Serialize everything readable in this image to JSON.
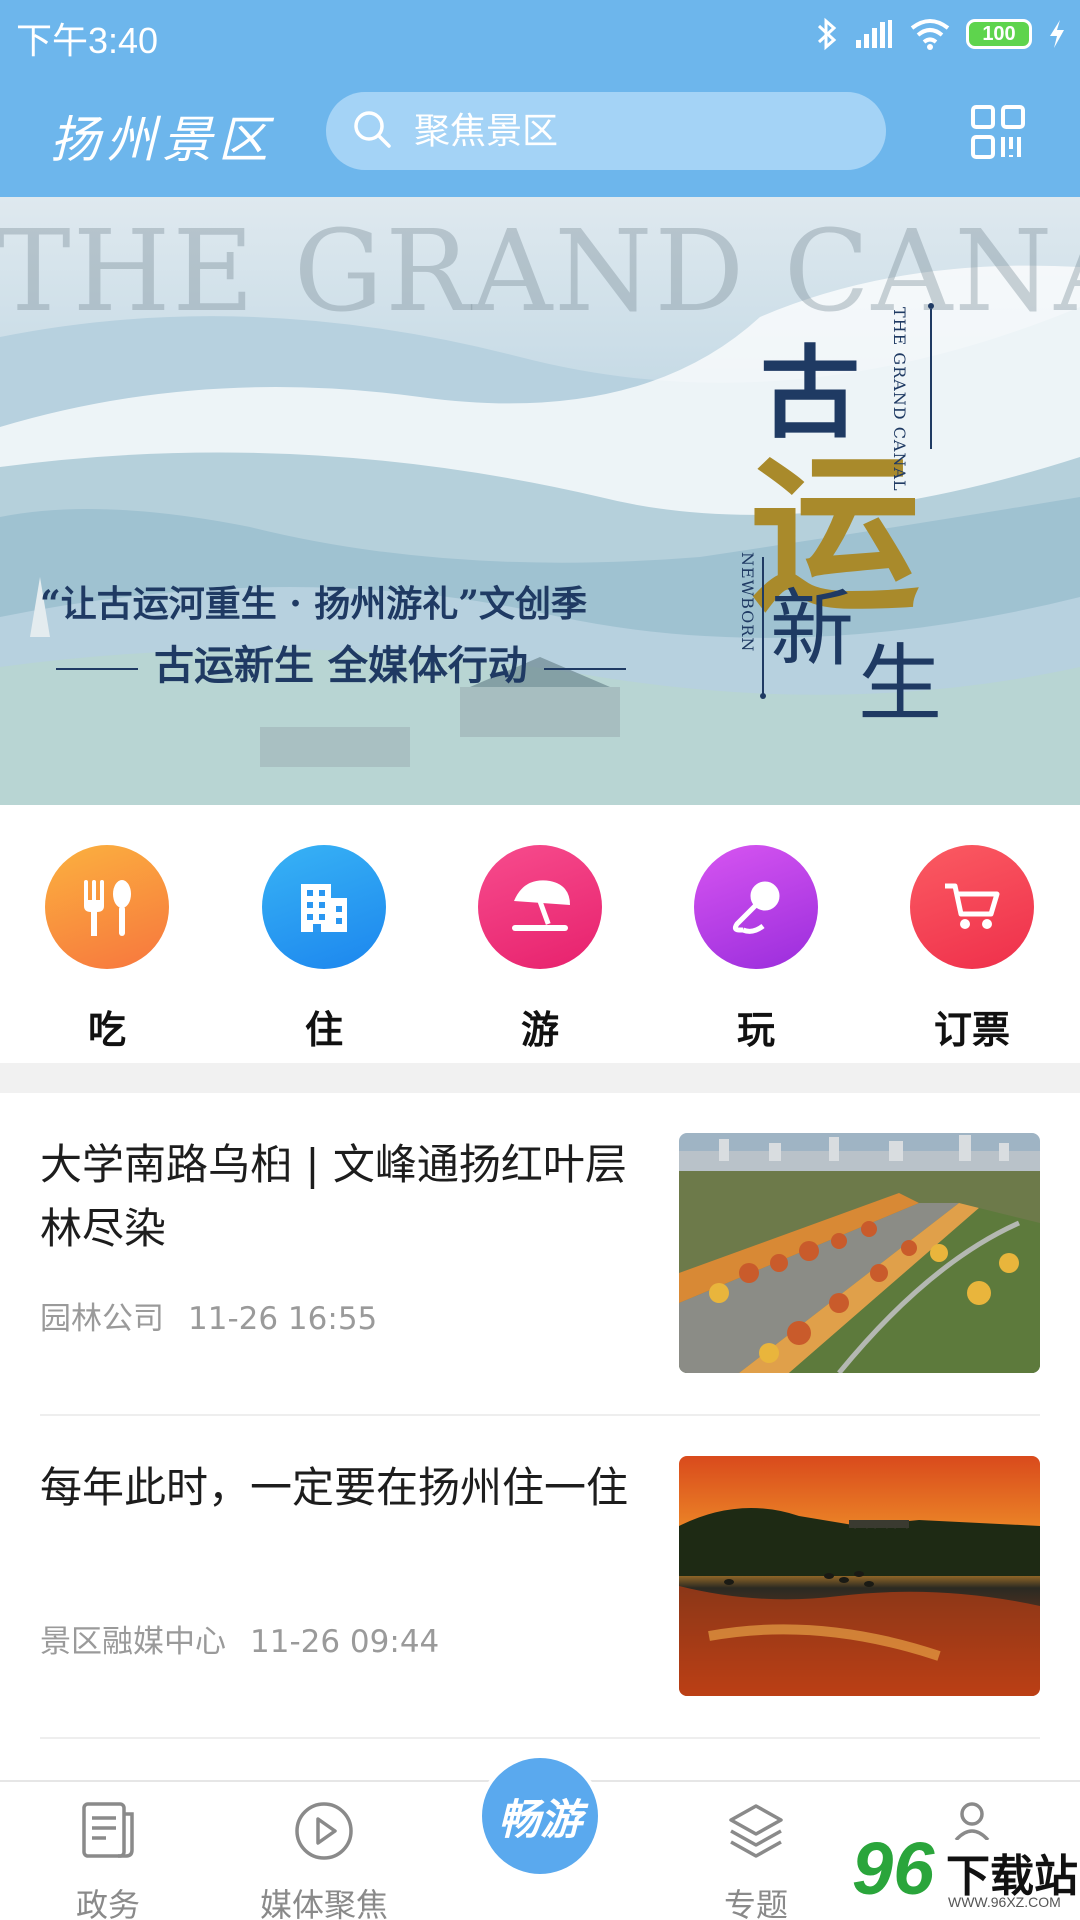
{
  "status_bar": {
    "time": "下午3:40",
    "battery": "100"
  },
  "header": {
    "app_title": "扬州景区",
    "search_placeholder": "聚焦景区",
    "qr_icon": "qr-code-icon"
  },
  "banner": {
    "bg_title_en": "THE GRAND CANAL",
    "line1": "“让古运河重生 · 扬州游礼”文创季",
    "line2": "古运新生 全媒体行动",
    "calligraphy": {
      "gu": "古",
      "yun": "运",
      "xin": "新",
      "sheng": "生"
    },
    "vertical_en_1": "THE GRAND CANAL",
    "vertical_en_2": "NEWBORN"
  },
  "categories": [
    {
      "label": "吃",
      "icon": "fork-spoon-icon",
      "color_from": "#fbb13f",
      "color_to": "#f7763e"
    },
    {
      "label": "住",
      "icon": "building-icon",
      "color_from": "#38b3f5",
      "color_to": "#1c86ee"
    },
    {
      "label": "游",
      "icon": "beach-umbrella-icon",
      "color_from": "#f74c8d",
      "color_to": "#e7216d"
    },
    {
      "label": "玩",
      "icon": "microphone-icon",
      "color_from": "#d755f1",
      "color_to": "#9a2ddc"
    },
    {
      "label": "订票",
      "icon": "cart-icon",
      "color_from": "#fb5b62",
      "color_to": "#ef2f4b"
    }
  ],
  "news": [
    {
      "title": "大学南路乌桕 | 文峰通扬红叶层林尽染",
      "source": "园林公司",
      "time": "11-26 16:55"
    },
    {
      "title": "每年此时，一定要在扬州住一住",
      "source": "景区融媒中心",
      "time": "11-26 09:44"
    }
  ],
  "bottom_nav": {
    "items": [
      {
        "label": "政务",
        "icon": "document-icon"
      },
      {
        "label": "媒体聚焦",
        "icon": "play-circle-icon"
      },
      {
        "label": "畅游",
        "icon": "center-tour-icon"
      },
      {
        "label": "专题",
        "icon": "layers-icon"
      },
      {
        "label": "",
        "icon": "user-icon"
      }
    ]
  },
  "watermark": {
    "number": "96",
    "text": "下载站",
    "url": "WWW.96XZ.COM"
  },
  "colors": {
    "header_bg": "#6db6ec",
    "search_bg": "#a4d3f6",
    "nav_center": "#5aa9ee"
  }
}
